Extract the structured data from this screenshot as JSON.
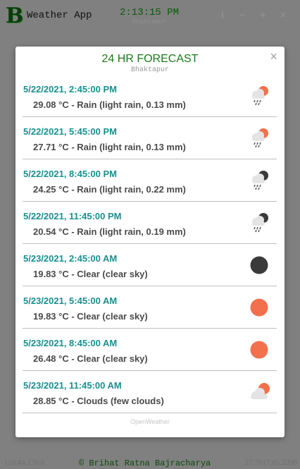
{
  "app": {
    "logo_letter": "B",
    "title": "Weather App",
    "clock": "2:13:15 PM",
    "city": "Bhaktapur",
    "window_buttons": [
      "i",
      "−",
      "+",
      "×"
    ]
  },
  "modal": {
    "title": "24 HR FORECAST",
    "subtitle": "Bhaktapur",
    "close_symbol": "×",
    "credit": "OpenWeather",
    "items": [
      {
        "time": "5/22/2021, 2:45:00 PM",
        "desc": "29.08 °C - Rain (light rain, 0.13 mm)",
        "icon": "rain-sun-icon"
      },
      {
        "time": "5/22/2021, 5:45:00 PM",
        "desc": "27.71 °C - Rain (light rain, 0.13 mm)",
        "icon": "rain-sun-icon"
      },
      {
        "time": "5/22/2021, 8:45:00 PM",
        "desc": "24.25 °C - Rain (light rain, 0.22 mm)",
        "icon": "rain-moon-icon"
      },
      {
        "time": "5/22/2021, 11:45:00 PM",
        "desc": "20.54 °C - Rain (light rain, 0.19 mm)",
        "icon": "rain-moon-icon"
      },
      {
        "time": "5/23/2021, 2:45:00 AM",
        "desc": "19.83 °C - Clear (clear sky)",
        "icon": "moon-icon"
      },
      {
        "time": "5/23/2021, 5:45:00 AM",
        "desc": "19.83 °C - Clear (clear sky)",
        "icon": "sun-icon"
      },
      {
        "time": "5/23/2021, 8:45:00 AM",
        "desc": "26.48 °C - Clear (clear sky)",
        "icon": "sun-icon"
      },
      {
        "time": "5/23/2021, 11:45:00 AM",
        "desc": "28.85 °C - Clouds (few clouds)",
        "icon": "cloud-sun-icon"
      }
    ]
  },
  "footer": {
    "ip": "110.44.120.6",
    "author": "© Brihat Ratna Bajracharya",
    "coords": "27.7017,85.3206"
  },
  "colors": {
    "accent_green": "#1a7a1a",
    "time_teal": "#1a8f8f",
    "sun_orange": "#f2704c",
    "moon_dark": "#3a3a3a",
    "backdrop": "#808080"
  }
}
